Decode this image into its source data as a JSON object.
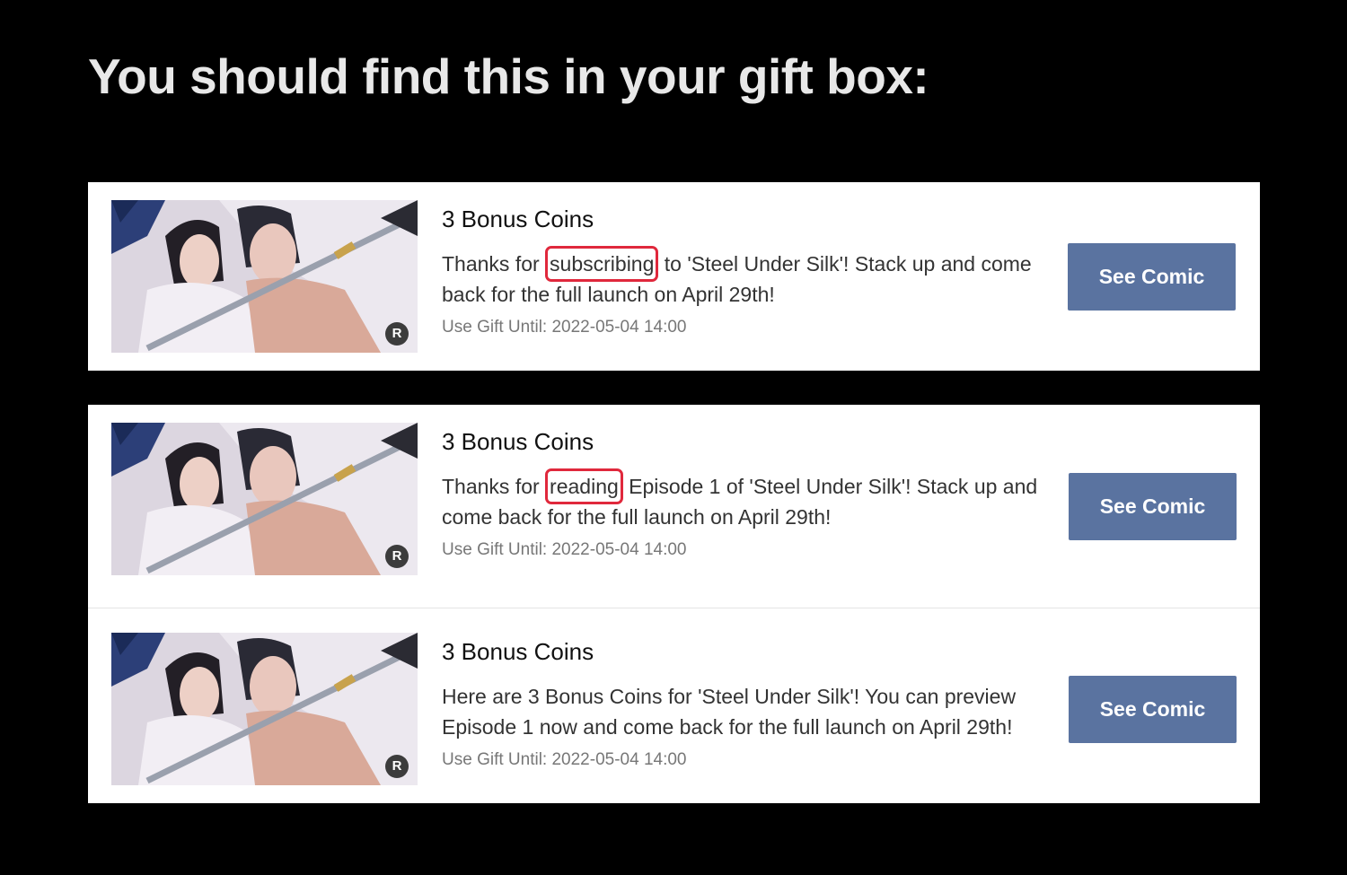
{
  "heading": "You should find this in your gift box:",
  "colors": {
    "background": "#000000",
    "card": "#ffffff",
    "button": "#5a73a0",
    "highlight": "#e0283c"
  },
  "gifts": [
    {
      "title": "3 Bonus Coins",
      "message_before": "Thanks for",
      "message_highlight": "subscribing",
      "message_after": "to 'Steel Under Silk'! Stack up and come back for the full launch on April 29th!",
      "expiry": "Use Gift Until: 2022-05-04 14:00",
      "button_label": "See Comic",
      "badge": "R",
      "thumbnail_icon": "comic-cover-image"
    },
    {
      "title": "3 Bonus Coins",
      "message_before": "Thanks for",
      "message_highlight": "reading",
      "message_after": "Episode 1 of 'Steel Under Silk'! Stack up and come back for the full launch on April 29th!",
      "expiry": "Use Gift Until: 2022-05-04 14:00",
      "button_label": "See Comic",
      "badge": "R",
      "thumbnail_icon": "comic-cover-image"
    },
    {
      "title": "3 Bonus Coins",
      "message": "Here are 3 Bonus Coins for 'Steel Under Silk'! You can preview Episode 1 now and come back for the full launch on April 29th!",
      "expiry": "Use Gift Until: 2022-05-04 14:00",
      "button_label": "See Comic",
      "badge": "R",
      "thumbnail_icon": "comic-cover-image"
    }
  ]
}
